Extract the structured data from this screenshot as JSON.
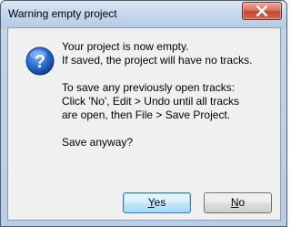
{
  "window": {
    "title": "Warning empty project"
  },
  "dialog": {
    "icon": "question-icon",
    "message_lines": [
      "Your project is now empty.",
      "If saved, the project will have no tracks.",
      "To save any previously open tracks:",
      "Click 'No', Edit > Undo until all tracks",
      "are open, then File > Save Project.",
      "Save anyway?"
    ]
  },
  "buttons": {
    "yes": {
      "accel": "Y",
      "rest": "es"
    },
    "no": {
      "accel": "N",
      "rest": "o"
    }
  },
  "colors": {
    "titlebar": "#c6d8ed",
    "client": "#f0f0f0",
    "close_button": "#c14a33",
    "default_button_border": "#3c7fb1",
    "icon_blue": "#1f5fc4"
  }
}
